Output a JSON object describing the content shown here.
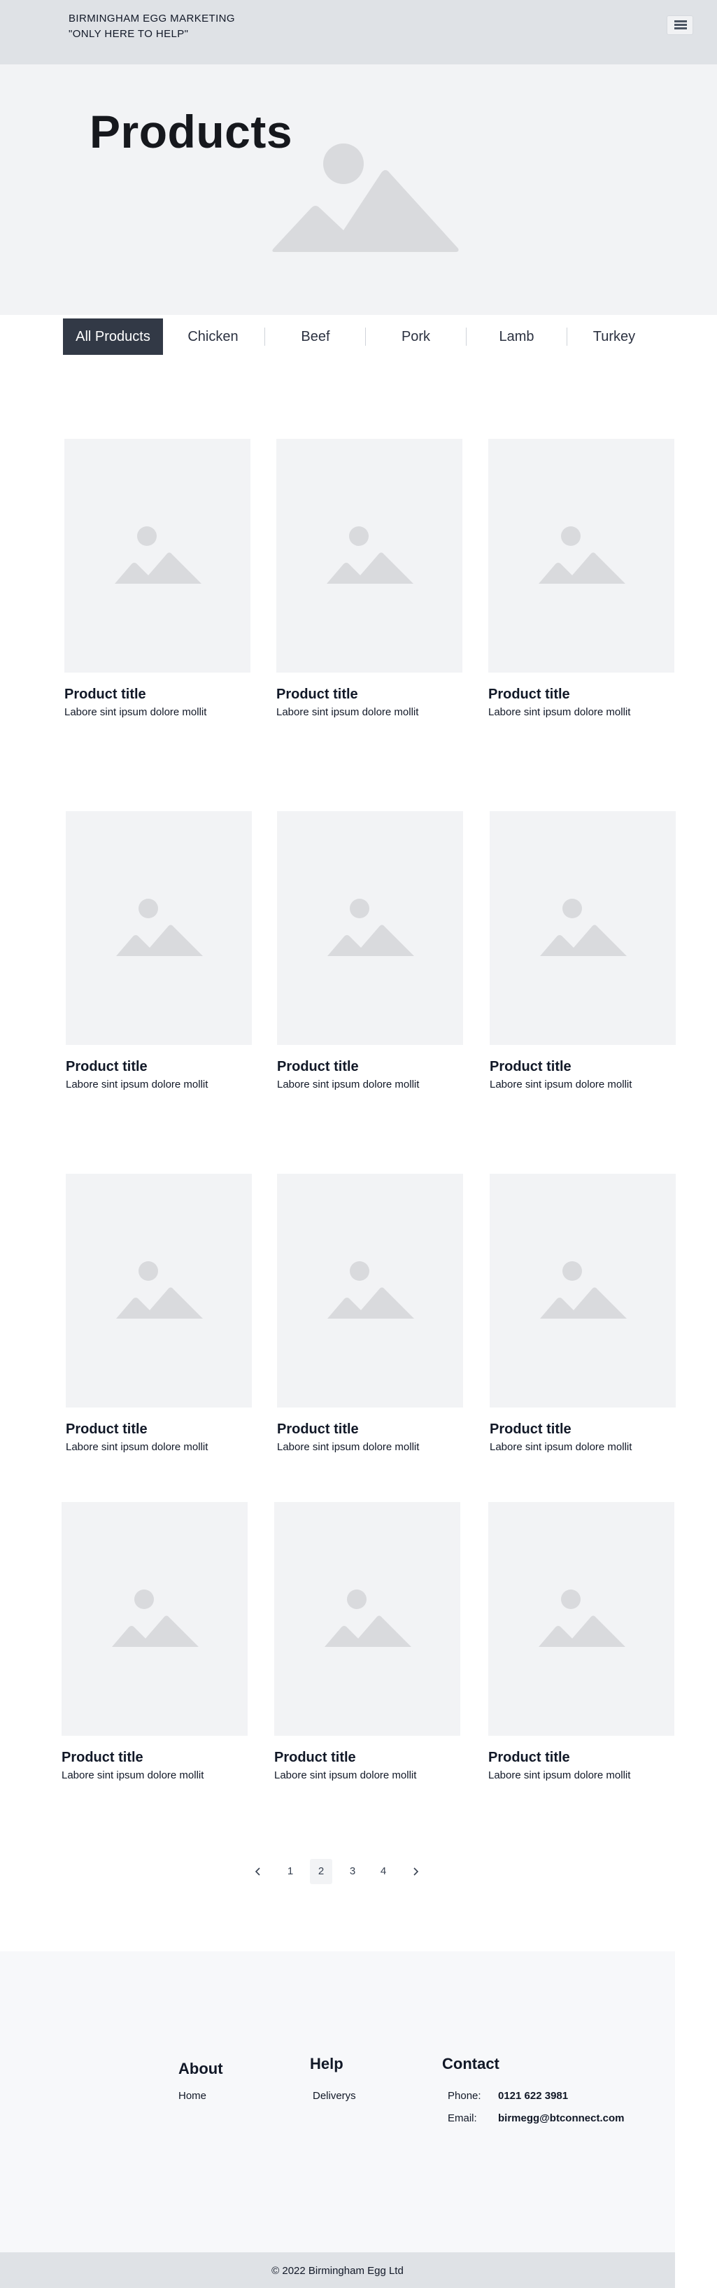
{
  "header": {
    "brand_line1": "BIRMINGHAM EGG  MARKETING",
    "brand_line2": "\"ONLY HERE TO HELP\"",
    "menu_icon": "hamburger-icon"
  },
  "hero": {
    "title": "Products",
    "image_icon": "image-placeholder-icon"
  },
  "tabs": [
    {
      "label": "All Products",
      "active": true
    },
    {
      "label": "Chicken",
      "active": false
    },
    {
      "label": "Beef",
      "active": false
    },
    {
      "label": "Pork",
      "active": false
    },
    {
      "label": "Lamb",
      "active": false
    },
    {
      "label": "Turkey",
      "active": false
    }
  ],
  "products": [
    {
      "title": "Product title",
      "desc": "Labore sint ipsum dolore mollit"
    },
    {
      "title": "Product title",
      "desc": "Labore sint ipsum dolore mollit"
    },
    {
      "title": "Product title",
      "desc": "Labore sint ipsum dolore mollit"
    },
    {
      "title": "Product title",
      "desc": "Labore sint ipsum dolore mollit"
    },
    {
      "title": "Product title",
      "desc": "Labore sint ipsum dolore mollit"
    },
    {
      "title": "Product title",
      "desc": "Labore sint ipsum dolore mollit"
    },
    {
      "title": "Product title",
      "desc": "Labore sint ipsum dolore mollit"
    },
    {
      "title": "Product title",
      "desc": "Labore sint ipsum dolore mollit"
    },
    {
      "title": "Product title",
      "desc": "Labore sint ipsum dolore mollit"
    },
    {
      "title": "Product title",
      "desc": "Labore sint ipsum dolore mollit"
    },
    {
      "title": "Product title",
      "desc": "Labore sint ipsum dolore mollit"
    },
    {
      "title": "Product title",
      "desc": "Labore sint ipsum dolore mollit"
    }
  ],
  "pagination": {
    "prev_icon": "chevron-left-icon",
    "next_icon": "chevron-right-icon",
    "pages": [
      "1",
      "2",
      "3",
      "4"
    ],
    "current": "2"
  },
  "footer": {
    "about": {
      "heading": "About",
      "links": [
        "Home"
      ]
    },
    "help": {
      "heading": "Help",
      "links": [
        "Deliverys"
      ]
    },
    "contact": {
      "heading": "Contact",
      "phone_label": "Phone:",
      "phone": "0121 622 3981",
      "email_label": "Email:",
      "email": "birmegg@btconnect.com"
    },
    "copyright": "© 2022 Birmingham Egg Ltd"
  },
  "colors": {
    "header_bg": "#dfe2e6",
    "hero_bg": "#f2f3f5",
    "active_tab_bg": "#323946",
    "placeholder_fill": "#d9dadd"
  }
}
